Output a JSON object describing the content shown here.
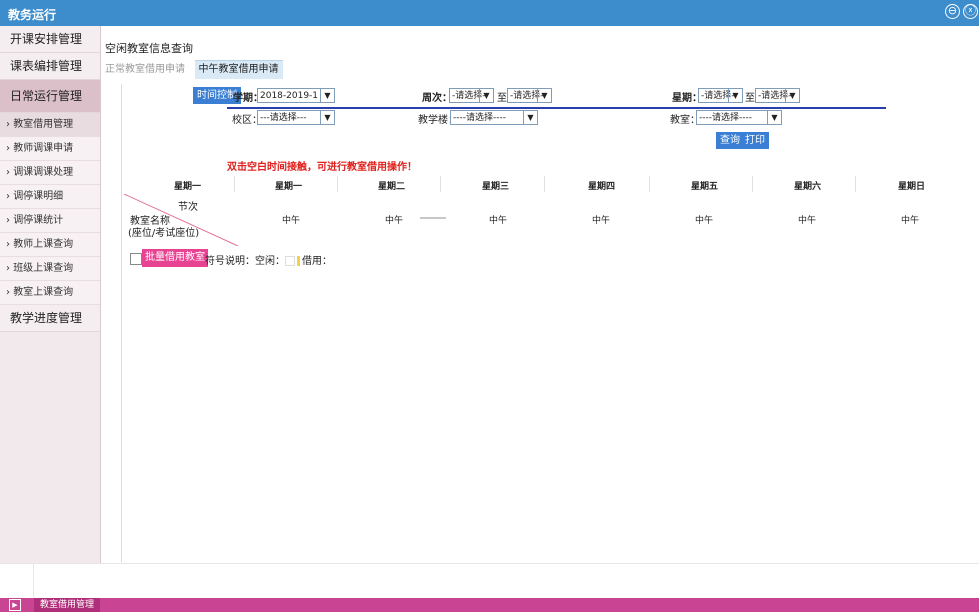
{
  "window": {
    "title": "教务运行",
    "minimize_glyph": "⊖",
    "close_glyph": "ⓧ"
  },
  "sidebar": {
    "main_items": [
      "开课安排管理",
      "课表编排管理",
      "日常运行管理",
      "教学进度管理"
    ],
    "sub_items": [
      "教室借用管理",
      "教师调课申请",
      "调课调课处理",
      "调停课明细",
      "调停课统计",
      "教师上课查询",
      "班级上课查询",
      "教室上课查询"
    ]
  },
  "content": {
    "breadcrumb": "空闲教室信息查询",
    "tabs": [
      "正常教室借用申请",
      "中午教室借用申请"
    ],
    "filters": {
      "time_control": "时间控制",
      "term_label": "学期：",
      "term_value": "2018-2019-1",
      "week_label": "周次：",
      "week_from": "-请选择-",
      "to_text": "至",
      "week_to": "-请选择-",
      "weekday_label": "星期：",
      "weekday_from": "-请选择-",
      "weekday_to": "-请选择-",
      "campus_label": "校区：",
      "campus_value": "---请选择---",
      "building_label": "教学楼：",
      "building_value": "----请选择----",
      "room_label": "教室：",
      "room_value": "----请选择----",
      "query_button": "查询",
      "print_button": "打印"
    },
    "hint": "双击空白时间接触，可进行教室借用操作！",
    "grid": {
      "weekdays": [
        "星期一",
        "星期一",
        "星期二",
        "星期三",
        "星期四",
        "星期五",
        "星期六",
        "星期日"
      ],
      "corner_section": "节次",
      "corner_room": "教室名称",
      "corner_seats": "(座位/考试座位)",
      "noon_label": "中午"
    },
    "batch_button": "批量借用教室",
    "legend_prefix": "符号说明：空闲：",
    "legend_used": "借用："
  },
  "bottom": {
    "tab_label": "教室借用管理"
  }
}
